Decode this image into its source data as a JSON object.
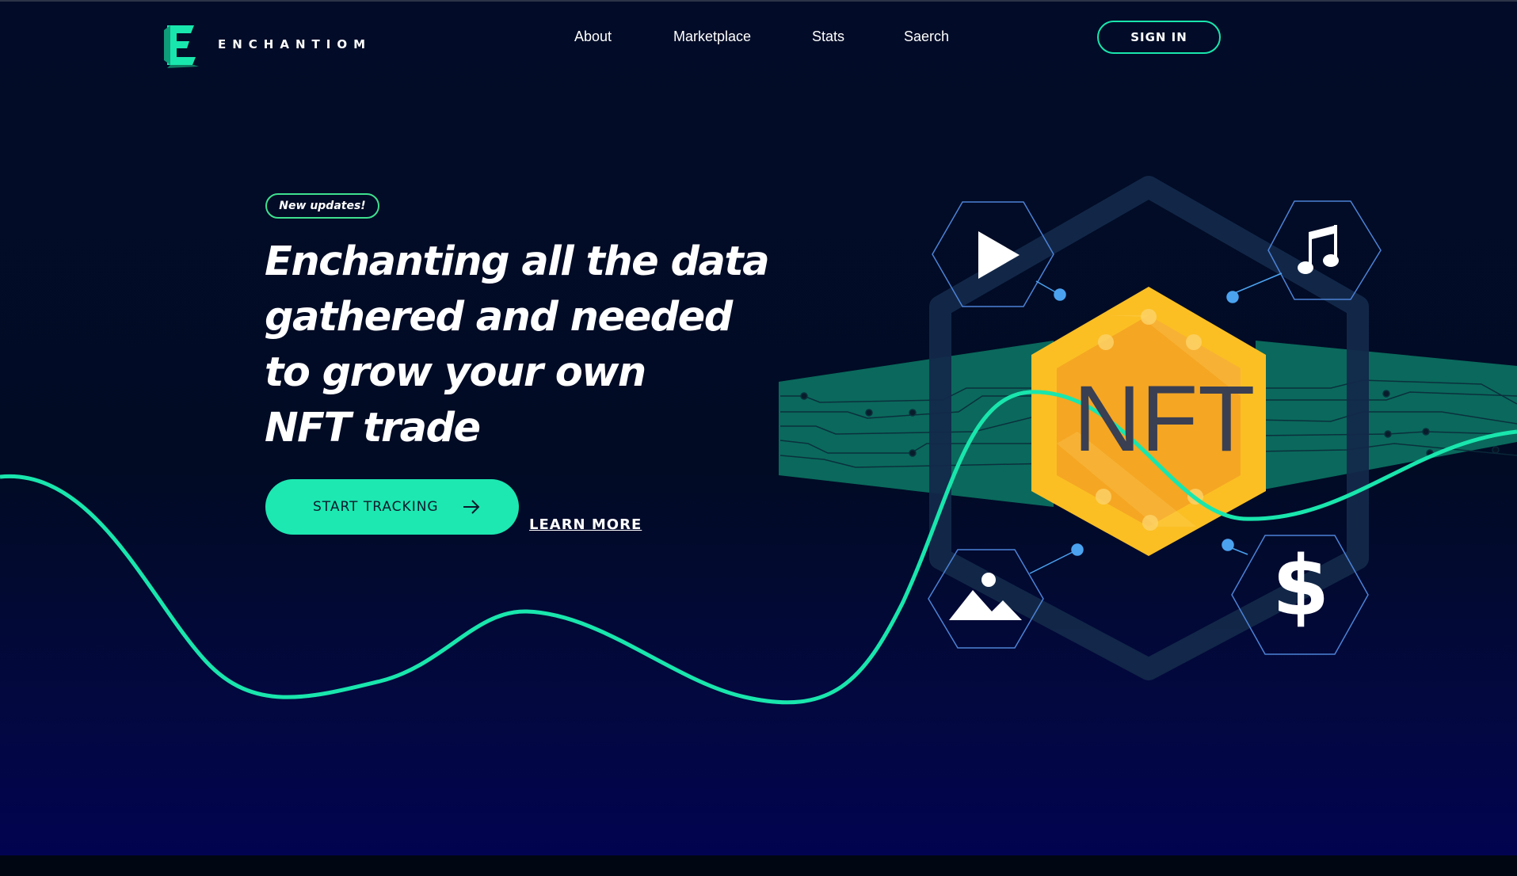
{
  "brand": {
    "name": "ENCHANTIOM"
  },
  "nav": {
    "items": [
      "About",
      "Marketplace",
      "Stats",
      "Saerch"
    ],
    "signin_label": "SIGN IN"
  },
  "hero": {
    "badge": "New updates!",
    "headline_lines": [
      "Enchanting all the data",
      "gathered and needed",
      "to grow your own",
      "NFT trade"
    ],
    "cta_label": "START TRACKING",
    "learn_more_label": "LEARN MORE"
  },
  "illustration": {
    "center_label": "NFT",
    "icons": [
      "play-icon",
      "music-note-icon",
      "image-icon",
      "dollar-icon"
    ],
    "dollar_symbol": "$"
  },
  "colors": {
    "accent": "#1de8b1",
    "background": "#020c28",
    "nft_gold": "#fbbf24",
    "node_blue": "#4ba3f0"
  }
}
